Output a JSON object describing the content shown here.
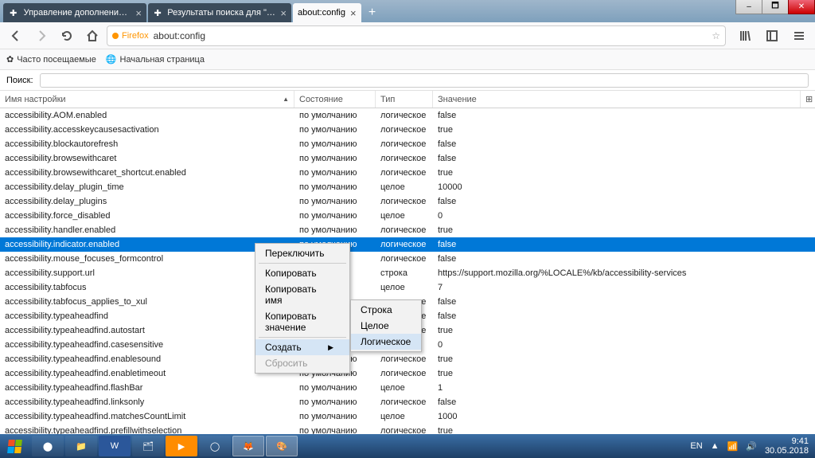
{
  "win_controls": {
    "min": "–",
    "max": "🗖",
    "close": "✕"
  },
  "tabs": [
    {
      "label": "Управление дополнениями",
      "icon": "puzzle",
      "active": false
    },
    {
      "label": "Результаты поиска для \"unity...",
      "icon": "puzzle",
      "active": false
    },
    {
      "label": "about:config",
      "icon": "",
      "active": true
    }
  ],
  "new_tab": "+",
  "nav": {
    "back": "←",
    "forward": "→",
    "reload": "⟳",
    "home": "⌂"
  },
  "url": {
    "brand": "Firefox",
    "text": "about:config",
    "star": "☆"
  },
  "right_icons": {
    "library": "📚",
    "sidebar": "▥",
    "menu": "≡"
  },
  "bookmarks": [
    {
      "icon": "⚙",
      "label": "Часто посещаемые"
    },
    {
      "icon": "🌐",
      "label": "Начальная страница"
    }
  ],
  "search": {
    "label": "Поиск:",
    "value": ""
  },
  "columns": {
    "name": "Имя настройки",
    "state": "Состояние",
    "type": "Тип",
    "value": "Значение",
    "sort": "▲",
    "cfg": "⊞"
  },
  "selected_index": 9,
  "prefs": [
    {
      "name": "accessibility.AOM.enabled",
      "state": "по умолчанию",
      "type": "логическое",
      "value": "false"
    },
    {
      "name": "accessibility.accesskeycausesactivation",
      "state": "по умолчанию",
      "type": "логическое",
      "value": "true"
    },
    {
      "name": "accessibility.blockautorefresh",
      "state": "по умолчанию",
      "type": "логическое",
      "value": "false"
    },
    {
      "name": "accessibility.browsewithcaret",
      "state": "по умолчанию",
      "type": "логическое",
      "value": "false"
    },
    {
      "name": "accessibility.browsewithcaret_shortcut.enabled",
      "state": "по умолчанию",
      "type": "логическое",
      "value": "true"
    },
    {
      "name": "accessibility.delay_plugin_time",
      "state": "по умолчанию",
      "type": "целое",
      "value": "10000"
    },
    {
      "name": "accessibility.delay_plugins",
      "state": "по умолчанию",
      "type": "логическое",
      "value": "false"
    },
    {
      "name": "accessibility.force_disabled",
      "state": "по умолчанию",
      "type": "целое",
      "value": "0"
    },
    {
      "name": "accessibility.handler.enabled",
      "state": "по умолчанию",
      "type": "логическое",
      "value": "true"
    },
    {
      "name": "accessibility.indicator.enabled",
      "state": "по умолчанию",
      "type": "логическое",
      "value": "false"
    },
    {
      "name": "accessibility.mouse_focuses_formcontrol",
      "state": "",
      "type": "логическое",
      "value": "false"
    },
    {
      "name": "accessibility.support.url",
      "state": "",
      "type": "строка",
      "value": "https://support.mozilla.org/%LOCALE%/kb/accessibility-services"
    },
    {
      "name": "accessibility.tabfocus",
      "state": "",
      "type": "целое",
      "value": "7"
    },
    {
      "name": "accessibility.tabfocus_applies_to_xul",
      "state": "",
      "type": "логическое",
      "value": "false"
    },
    {
      "name": "accessibility.typeaheadfind",
      "state": "",
      "type": "логическое",
      "value": "false"
    },
    {
      "name": "accessibility.typeaheadfind.autostart",
      "state": "",
      "type": "логическое",
      "value": "true"
    },
    {
      "name": "accessibility.typeaheadfind.casesensitive",
      "state": "по умолчанию",
      "type": "целое",
      "value": "0"
    },
    {
      "name": "accessibility.typeaheadfind.enablesound",
      "state": "по умолчанию",
      "type": "логическое",
      "value": "true"
    },
    {
      "name": "accessibility.typeaheadfind.enabletimeout",
      "state": "по умолчанию",
      "type": "логическое",
      "value": "true"
    },
    {
      "name": "accessibility.typeaheadfind.flashBar",
      "state": "по умолчанию",
      "type": "целое",
      "value": "1"
    },
    {
      "name": "accessibility.typeaheadfind.linksonly",
      "state": "по умолчанию",
      "type": "логическое",
      "value": "false"
    },
    {
      "name": "accessibility.typeaheadfind.matchesCountLimit",
      "state": "по умолчанию",
      "type": "целое",
      "value": "1000"
    },
    {
      "name": "accessibility.typeaheadfind.prefillwithselection",
      "state": "по умолчанию",
      "type": "логическое",
      "value": "true"
    }
  ],
  "context_menu": {
    "toggle": "Переключить",
    "copy": "Копировать",
    "copy_name": "Копировать имя",
    "copy_value": "Копировать значение",
    "create": "Создать",
    "reset": "Сбросить",
    "submenu": {
      "string": "Строка",
      "integer": "Целое",
      "boolean": "Логическое"
    }
  },
  "taskbar": {
    "lang": "EN",
    "date": "30.05.2018",
    "time": "9:41"
  }
}
